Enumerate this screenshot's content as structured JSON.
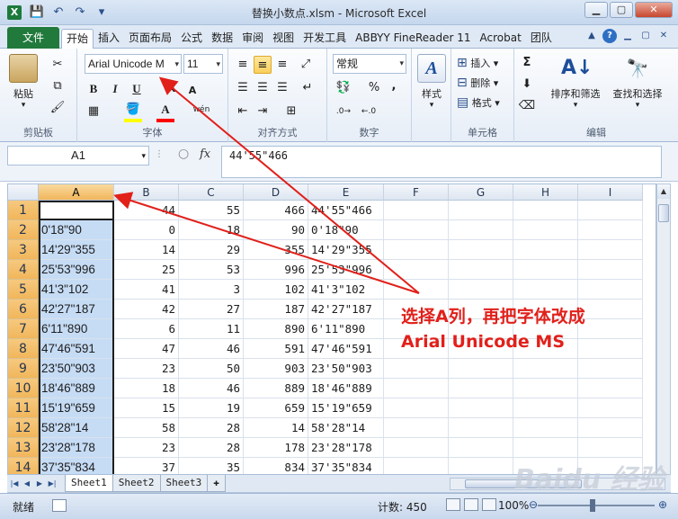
{
  "window": {
    "title": "替换小数点.xlsm - Microsoft Excel",
    "app_icon": "X",
    "controls": [
      "▁",
      "▢",
      "✕"
    ]
  },
  "quick_access": [
    "💾",
    "↶",
    "↷",
    "▾"
  ],
  "ribbon_tabs": {
    "file": "文件",
    "items": [
      "开始",
      "插入",
      "页面布局",
      "公式",
      "数据",
      "审阅",
      "视图",
      "开发工具",
      "ABBYY FineReader 11",
      "Acrobat",
      "团队"
    ],
    "active_index": 0
  },
  "ribbon": {
    "clipboard": {
      "label": "剪贴板",
      "paste": "粘贴"
    },
    "font": {
      "label": "字体",
      "name": "Arial Unicode M",
      "size": "11",
      "bold": "B",
      "italic": "I",
      "underline": "U",
      "grow": "A",
      "shrink": "A",
      "fill_color": "#ffff00",
      "font_color": "#ff0000"
    },
    "alignment": {
      "label": "对齐方式"
    },
    "number": {
      "label": "数字",
      "format": "常规",
      "percent": "%",
      "comma": ","
    },
    "styles": {
      "label": "",
      "button": "样式"
    },
    "cells": {
      "label": "单元格",
      "insert": "插入",
      "delete": "删除",
      "format": "格式"
    },
    "editing": {
      "label": "编辑",
      "sum": "Σ",
      "sort_filter": "排序和筛选",
      "find_select": "查找和选择"
    }
  },
  "formula_bar": {
    "name_box": "A1",
    "fx": "fx",
    "content": "44'55\"466"
  },
  "columns": [
    "A",
    "B",
    "C",
    "D",
    "E",
    "F",
    "G",
    "H",
    "I"
  ],
  "rows": [
    {
      "n": "1",
      "a": "44'55\"466",
      "b": "44",
      "c": "55",
      "d": "466",
      "e": "44'55\"466"
    },
    {
      "n": "2",
      "a": "0'18\"90",
      "b": "0",
      "c": "18",
      "d": "90",
      "e": "0'18\"90"
    },
    {
      "n": "3",
      "a": "14'29\"355",
      "b": "14",
      "c": "29",
      "d": "355",
      "e": "14'29\"355"
    },
    {
      "n": "4",
      "a": "25'53\"996",
      "b": "25",
      "c": "53",
      "d": "996",
      "e": "25'53\"996"
    },
    {
      "n": "5",
      "a": "41'3\"102",
      "b": "41",
      "c": "3",
      "d": "102",
      "e": "41'3\"102"
    },
    {
      "n": "6",
      "a": "42'27\"187",
      "b": "42",
      "c": "27",
      "d": "187",
      "e": "42'27\"187"
    },
    {
      "n": "7",
      "a": "6'11\"890",
      "b": "6",
      "c": "11",
      "d": "890",
      "e": "6'11\"890"
    },
    {
      "n": "8",
      "a": "47'46\"591",
      "b": "47",
      "c": "46",
      "d": "591",
      "e": "47'46\"591"
    },
    {
      "n": "9",
      "a": "23'50\"903",
      "b": "23",
      "c": "50",
      "d": "903",
      "e": "23'50\"903"
    },
    {
      "n": "10",
      "a": "18'46\"889",
      "b": "18",
      "c": "46",
      "d": "889",
      "e": "18'46\"889"
    },
    {
      "n": "11",
      "a": "15'19\"659",
      "b": "15",
      "c": "19",
      "d": "659",
      "e": "15'19\"659"
    },
    {
      "n": "12",
      "a": "58'28\"14",
      "b": "58",
      "c": "28",
      "d": "14",
      "e": "58'28\"14"
    },
    {
      "n": "13",
      "a": "23'28\"178",
      "b": "23",
      "c": "28",
      "d": "178",
      "e": "23'28\"178"
    },
    {
      "n": "14",
      "a": "37'35\"834",
      "b": "37",
      "c": "35",
      "d": "834",
      "e": "37'35\"834"
    }
  ],
  "sheets": [
    "Sheet1",
    "Sheet2",
    "Sheet3"
  ],
  "active_sheet": 0,
  "status": {
    "ready": "就绪",
    "count": "计数: 450",
    "zoom": "100%"
  },
  "annotation": {
    "line1": "选择A列，再把字体改成",
    "line2": "Arial Unicode MS",
    "color": "#e1201a"
  },
  "watermark": "Baidu 经验"
}
